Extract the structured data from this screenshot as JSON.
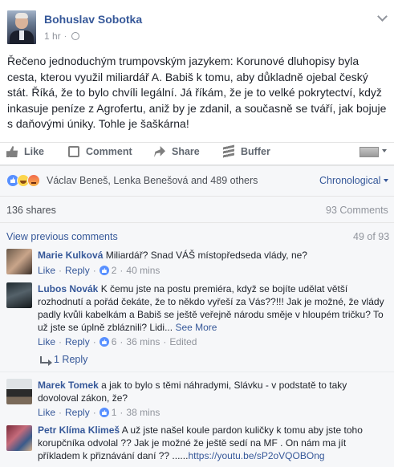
{
  "post": {
    "author": "Bohuslav Sobotka",
    "time": "1 hr",
    "text": "Řečeno jednoduchým trumpovským jazykem: Korunové dluhopisy byla cesta, kterou využil miliardář A. Babiš k tomu, aby důkladně ojebal český stát. Říká, že to bylo chvíli legální. Já říkám, že je to velké pokrytectví, když inkasuje peníze z Agrofertu, aniž by je zdanil, a současně se tváří, jak bojuje s daňovými úniky. Tohle je šaškárna!"
  },
  "actions": {
    "like": "Like",
    "comment": "Comment",
    "share": "Share",
    "buffer": "Buffer"
  },
  "reactions": {
    "names": "Václav Beneš, Lenka Benešová and 489 others",
    "order": "Chronological"
  },
  "stats": {
    "shares": "136 shares",
    "comments": "93 Comments"
  },
  "view_previous": {
    "label": "View previous comments",
    "count": "49 of 93"
  },
  "comments": [
    {
      "name": "Marie Kulková",
      "text": "Miliardář? Snad VÁŠ místopředseda vlády, ne?",
      "like": "Like",
      "reply": "Reply",
      "likes": "2",
      "time": "40 mins"
    },
    {
      "name": "Lubos Novák",
      "text": "K čemu jste na postu premiéra, když se bojíte udělat větší rozhodnutí a pořád čekáte, že to někdo vyřeší za Vás??!!! Jak je možné, že vlády padly kvůli kabelkám a Babiš se ještě veřejně národu směje v hloupém tričku? To už jste se úplně zbláznili? Lidi...",
      "see_more": "See More",
      "like": "Like",
      "reply": "Reply",
      "likes": "6",
      "time": "36 mins",
      "edited": "Edited",
      "replies": "1 Reply"
    },
    {
      "name": "Marek Tomek",
      "text": "a jak to bylo s těmi náhradymi, Slávku - v podstatě to taky dovoloval zákon, že?",
      "like": "Like",
      "reply": "Reply",
      "likes": "1",
      "time": "38 mins"
    },
    {
      "name": "Petr Klíma Klimeš",
      "text": "A už jste našel koule pardon kuličky k tomu aby jste toho korupčníka odvolal ?? Jak je možné že ještě sedí na MF . On nám ma jít příkladem k přiznávání daní ?? ......",
      "link": "https://youtu.be/sP2oVQOBOng"
    }
  ]
}
